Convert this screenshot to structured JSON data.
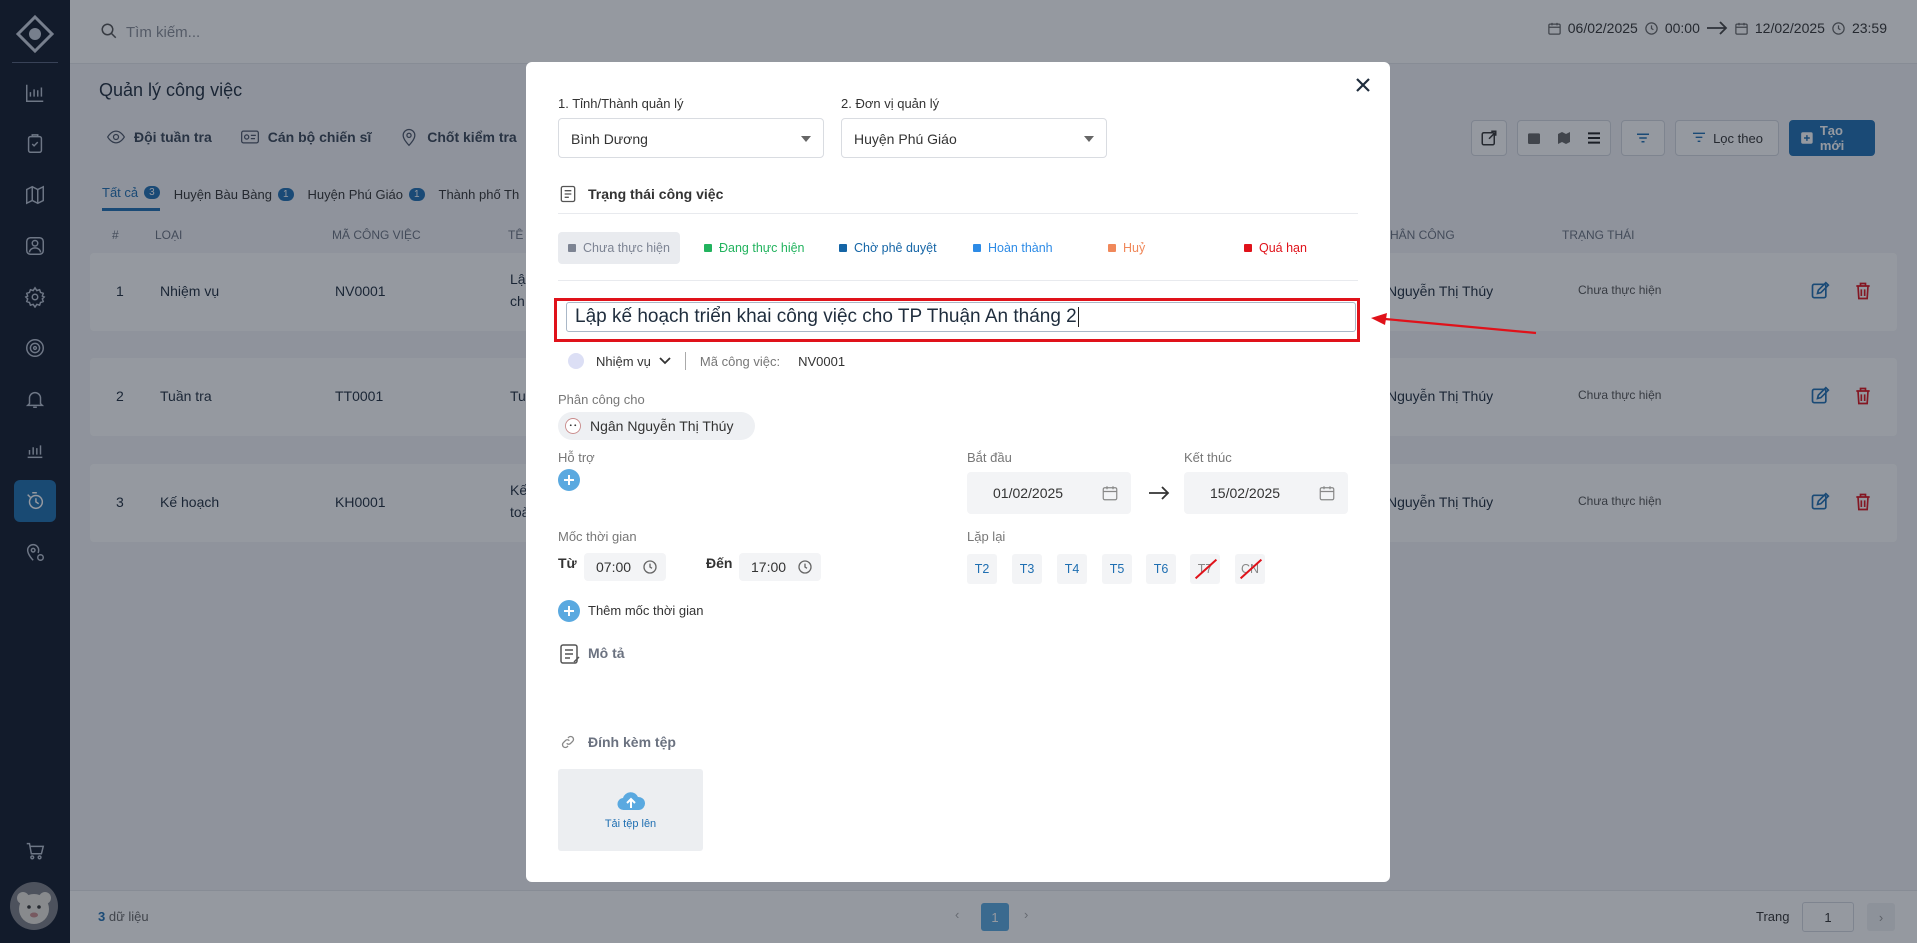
{
  "search": {
    "placeholder": "Tìm kiếm..."
  },
  "daterange": {
    "start_date": "06/02/2025",
    "start_time": "00:00",
    "end_date": "12/02/2025",
    "end_time": "23:59"
  },
  "page": {
    "title": "Quản lý công việc"
  },
  "toolbar_tabs": [
    "Đội tuần tra",
    "Cán bộ chiến sĩ",
    "Chốt kiểm tra"
  ],
  "tools": {
    "filter_label": "Lọc theo",
    "create_label": "Tạo mới"
  },
  "filter_tabs": [
    {
      "label": "Tất cả",
      "count": "3"
    },
    {
      "label": "Huyện Bàu Bàng",
      "count": "1"
    },
    {
      "label": "Huyện Phú Giáo",
      "count": "1"
    },
    {
      "label": "Thành phố Th",
      "count": ""
    }
  ],
  "table": {
    "headers": [
      "#",
      "LOẠI",
      "MÃ CÔNG VIỆC",
      "TÊ",
      "HÂN CÔNG",
      "TRẠNG THÁI"
    ],
    "rows": [
      {
        "no": "1",
        "type": "Nhiệm vụ",
        "code": "NV0001",
        "name": "Lậ",
        "name2": "ch",
        "assignee": "Nguyễn Thị Thúy",
        "status": "Chưa thực hiện"
      },
      {
        "no": "2",
        "type": "Tuần tra",
        "code": "TT0001",
        "name": "Tu",
        "name2": "",
        "assignee": "Nguyễn Thị Thúy",
        "status": "Chưa thực hiện"
      },
      {
        "no": "3",
        "type": "Kế hoạch",
        "code": "KH0001",
        "name": "Kế",
        "name2": "toà",
        "assignee": "Nguyễn Thị Thúy",
        "status": "Chưa thực hiện"
      }
    ]
  },
  "footer": {
    "count": "3",
    "count_label": "dữ liệu",
    "current_page": "1",
    "page_label": "Trang",
    "page_input": "1"
  },
  "modal": {
    "province_label": "1. Tỉnh/Thành quản lý",
    "province_value": "Bình Dương",
    "unit_label": "2. Đơn vị quản lý",
    "unit_value": "Huyện Phú Giáo",
    "status_heading": "Trạng thái công việc",
    "statuses": [
      {
        "label": "Chưa thực hiện",
        "color": "#7d8493"
      },
      {
        "label": "Đang thực hiện",
        "color": "#22b35e"
      },
      {
        "label": "Chờ phê duyệt",
        "color": "#1565a6"
      },
      {
        "label": "Hoàn thành",
        "color": "#2d8be6"
      },
      {
        "label": "Huỷ",
        "color": "#f0885a"
      },
      {
        "label": "Quá hạn",
        "color": "#e0121a"
      }
    ],
    "task_title": "Lập kế hoạch triển khai công việc cho TP Thuận An tháng 2",
    "task_type": "Nhiệm vụ",
    "code_label": "Mã công việc:",
    "code_value": "NV0001",
    "assign_label": "Phân công cho",
    "assignee": "Ngân Nguyễn Thị Thúy",
    "support_label": "Hỗ trợ",
    "start_label": "Bắt đầu",
    "start_value": "01/02/2025",
    "end_label": "Kết thúc",
    "end_value": "15/02/2025",
    "timeline_label": "Mốc thời gian",
    "from_label": "Từ",
    "from_value": "07:00",
    "to_label": "Đến",
    "to_value": "17:00",
    "repeat_label": "Lặp lại",
    "days": [
      "T2",
      "T3",
      "T4",
      "T5",
      "T6",
      "T7",
      "CN"
    ],
    "add_timeline_label": "Thêm mốc thời gian",
    "desc_label": "Mô tả",
    "attach_label": "Đính kèm tệp",
    "upload_label": "Tải tệp lên"
  },
  "annotation": {
    "color": "#e0121a"
  }
}
